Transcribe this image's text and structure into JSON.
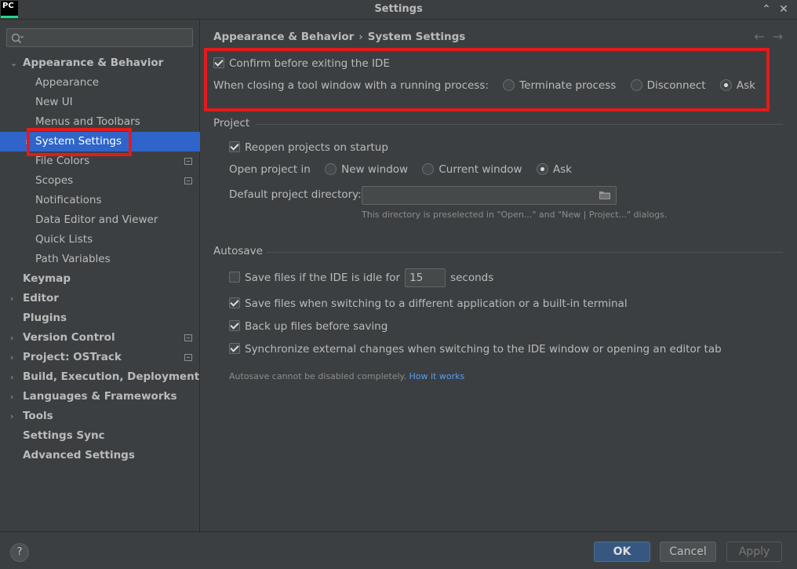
{
  "window": {
    "logo_line1": "PC",
    "logo_line2": "",
    "title": "Settings",
    "minimize": "⌃",
    "close": "✕"
  },
  "search": {
    "value": "",
    "placeholder": ""
  },
  "sidebar": {
    "items": [
      {
        "label": "Appearance & Behavior",
        "arrow": "⌄"
      },
      {
        "label": "Appearance"
      },
      {
        "label": "New UI"
      },
      {
        "label": "Menus and Toolbars"
      },
      {
        "label": "System Settings",
        "arrow": "›"
      },
      {
        "label": "File Colors"
      },
      {
        "label": "Scopes"
      },
      {
        "label": "Notifications"
      },
      {
        "label": "Data Editor and Viewer"
      },
      {
        "label": "Quick Lists"
      },
      {
        "label": "Path Variables"
      },
      {
        "label": "Keymap"
      },
      {
        "label": "Editor",
        "arrow": "›"
      },
      {
        "label": "Plugins"
      },
      {
        "label": "Version Control",
        "arrow": "›"
      },
      {
        "label": "Project: OSTrack",
        "arrow": "›"
      },
      {
        "label": "Build, Execution, Deployment",
        "arrow": "›"
      },
      {
        "label": "Languages & Frameworks",
        "arrow": "›"
      },
      {
        "label": "Tools",
        "arrow": "›"
      },
      {
        "label": "Settings Sync"
      },
      {
        "label": "Advanced Settings"
      }
    ]
  },
  "breadcrumb": {
    "parent": "Appearance & Behavior",
    "separator": "›",
    "current": "System Settings"
  },
  "nav": {
    "back": "←",
    "forward": "→"
  },
  "general": {
    "confirm_exit": "Confirm before exiting the IDE",
    "closing_label": "When closing a tool window with a running process:",
    "opt_terminate": "Terminate process",
    "opt_disconnect": "Disconnect",
    "opt_ask": "Ask"
  },
  "project": {
    "title": "Project",
    "reopen": "Reopen projects on startup",
    "open_in_label": "Open project in",
    "opt_new_window": "New window",
    "opt_current_window": "Current window",
    "opt_ask": "Ask",
    "default_dir_label": "Default project directory:",
    "default_dir_value": "",
    "default_dir_hint": "This directory is preselected in \"Open...\" and \"New | Project...\" dialogs."
  },
  "autosave": {
    "title": "Autosave",
    "idle_prefix": "Save files if the IDE is idle for",
    "idle_value": "15",
    "idle_suffix": "seconds",
    "switching": "Save files when switching to a different application or a built-in terminal",
    "backup": "Back up files before saving",
    "sync": "Synchronize external changes when switching to the IDE window or opening an editor tab",
    "note": "Autosave cannot be disabled completely.",
    "note_link": "How it works"
  },
  "footer": {
    "help": "?",
    "ok": "OK",
    "cancel": "Cancel",
    "apply": "Apply"
  },
  "colors": {
    "accent": "#2f65ca",
    "highlight": "#e21b1b",
    "link": "#589df6"
  }
}
